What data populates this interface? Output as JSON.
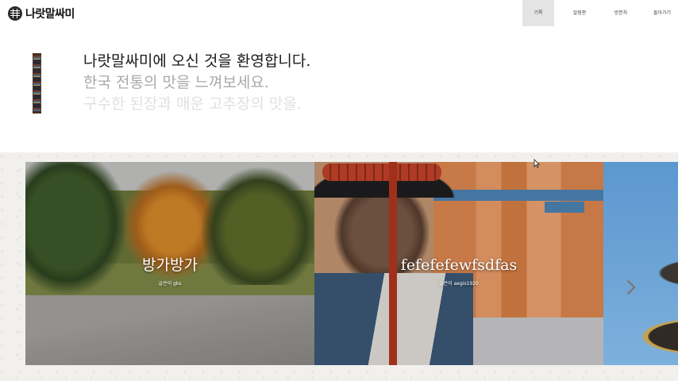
{
  "brand": {
    "name": "나랏말싸미"
  },
  "nav": {
    "items": [
      {
        "label": "기록",
        "active": true
      },
      {
        "label": "알림판",
        "active": false
      },
      {
        "label": "방문자",
        "active": false
      },
      {
        "label": "돌아가기",
        "active": false
      }
    ]
  },
  "welcome": {
    "line1": "나랏말싸미에 오신 것을 환영합니다.",
    "line2": "한국 전통의 맛을 느껴보세요.",
    "line3": "구수한 된장과 매운 고추장의 맛을."
  },
  "gallery": {
    "slides": [
      {
        "title": "방가방가",
        "author": "글쓴이 gks"
      },
      {
        "title": "fefefefewfsdfas",
        "author": "글쓴이 aegis1920"
      },
      {
        "title": "",
        "author": ""
      }
    ],
    "next_icon": "chevron-right-icon"
  },
  "colors": {
    "text_dark": "#1a1a1a",
    "text_mid": "#a9a9a9",
    "text_light": "#e0e0e0",
    "nav_active_bg": "#e4e4e4"
  }
}
